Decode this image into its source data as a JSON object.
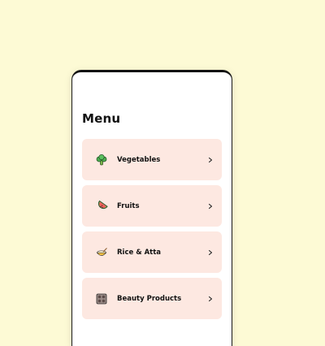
{
  "menu": {
    "title": "Menu",
    "items": [
      {
        "label": "Vegetables",
        "icon": "broccoli-icon"
      },
      {
        "label": "Fruits",
        "icon": "watermelon-icon"
      },
      {
        "label": "Rice & Atta",
        "icon": "rice-bowl-icon"
      },
      {
        "label": "Beauty Products",
        "icon": "makeup-palette-icon"
      }
    ]
  },
  "colors": {
    "background": "#fdfad5",
    "card": "#fde8e1",
    "text": "#111111"
  }
}
